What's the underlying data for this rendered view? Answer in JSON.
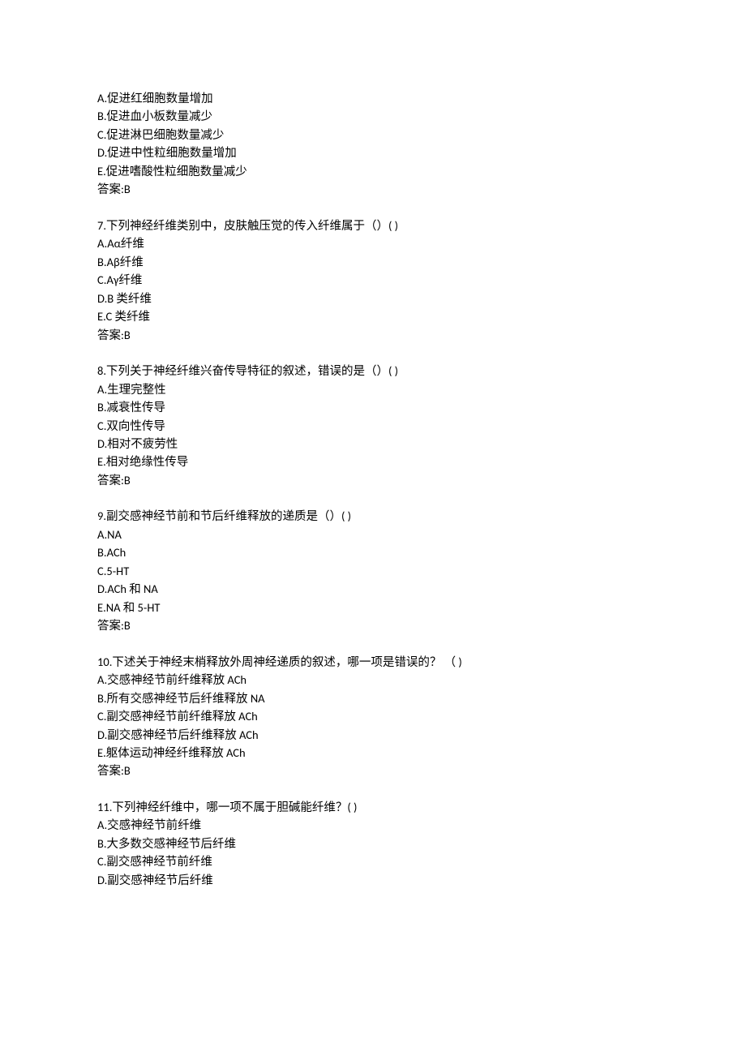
{
  "q6_partial": {
    "options": [
      {
        "label": "A.促进红细胞数量增加"
      },
      {
        "label": "B.促进血小板数量减少"
      },
      {
        "label": "C.促进淋巴细胞数量减少"
      },
      {
        "label": "D.促进中性粒细胞数量增加"
      },
      {
        "label": "E.促进嗜酸性粒细胞数量减少"
      }
    ],
    "answer": "答案:B"
  },
  "questions": [
    {
      "stem": "7.下列神经纤维类别中，皮肤触压觉的传入纤维属于（）( )",
      "options": [
        {
          "label": "A.Aα纤维"
        },
        {
          "label": "B.Aβ纤维"
        },
        {
          "label": "C.Aγ纤维"
        },
        {
          "label": "D.B 类纤维"
        },
        {
          "label": "E.C 类纤维"
        }
      ],
      "answer": "答案:B"
    },
    {
      "stem": "8.下列关于神经纤维兴奋传导特征的叙述，错误的是（）( )",
      "options": [
        {
          "label": "A.生理完整性"
        },
        {
          "label": "B.减衰性传导"
        },
        {
          "label": "C.双向性传导"
        },
        {
          "label": "D.相对不疲劳性"
        },
        {
          "label": "E.相对绝缘性传导"
        }
      ],
      "answer": "答案:B"
    },
    {
      "stem": "9.副交感神经节前和节后纤维释放的递质是（）( )",
      "options": [
        {
          "label": "A.NA"
        },
        {
          "label": "B.ACh"
        },
        {
          "label": "C.5-HT"
        },
        {
          "label": "D.ACh 和 NA"
        },
        {
          "label": "E.NA 和 5-HT"
        }
      ],
      "answer": "答案:B"
    },
    {
      "stem": "10.下述关于神经末梢释放外周神经递质的叙述，哪一项是错误的？ （ )",
      "options": [
        {
          "label": "A.交感神经节前纤维释放 ACh"
        },
        {
          "label": "B.所有交感神经节后纤维释放 NA"
        },
        {
          "label": "C.副交感神经节前纤维释放 ACh"
        },
        {
          "label": "D.副交感神经节后纤维释放 ACh"
        },
        {
          "label": "E.躯体运动神经纤维释放 ACh"
        }
      ],
      "answer": "答案:B"
    },
    {
      "stem": "11.下列神经纤维中，哪一项不属于胆碱能纤维？( )",
      "options": [
        {
          "label": "A.交感神经节前纤维"
        },
        {
          "label": "B.大多数交感神经节后纤维"
        },
        {
          "label": "C.副交感神经节前纤维"
        },
        {
          "label": "D.副交感神经节后纤维"
        }
      ],
      "answer": ""
    }
  ]
}
